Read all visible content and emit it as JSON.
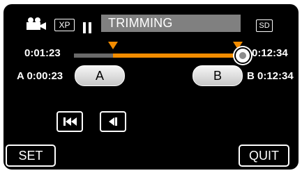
{
  "header": {
    "mode_badge": "XP",
    "title": "TRIMMING",
    "media_badge": "SD"
  },
  "timeline": {
    "current_time": "0:01:23",
    "total_time": "0:12:34",
    "trim_start_fraction": 0.233,
    "trim_end_fraction": 1.0
  },
  "points": {
    "a_label": "A",
    "a_time": "A 0:00:23",
    "b_label": "B",
    "b_time": "B 0:12:34"
  },
  "controls": {
    "skip_back_icon": "skip-to-start-icon",
    "frame_back_icon": "frame-step-back-icon"
  },
  "footer": {
    "set_label": "SET",
    "quit_label": "QUIT"
  },
  "colors": {
    "accent": "#f28c00",
    "title_bar": "#808080"
  }
}
